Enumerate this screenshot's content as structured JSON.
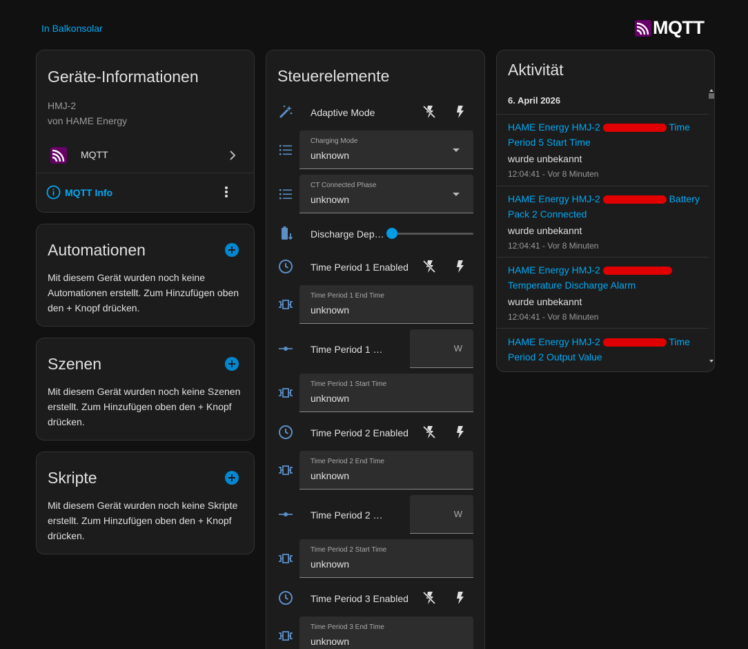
{
  "breadcrumb": "In Balkonsolar",
  "brand": {
    "name": "MQTT"
  },
  "colors": {
    "accent": "#03a9f4",
    "card_bg": "#1c1c1c",
    "page_bg": "#111111",
    "redaction": "#e00000"
  },
  "device_info": {
    "title": "Geräte-Informationen",
    "model": "HMJ-2",
    "vendor": "von HAME Energy",
    "integration_label": "MQTT",
    "info_link": "MQTT Info"
  },
  "automations": {
    "title": "Automationen",
    "description": "Mit diesem Gerät wurden noch keine Automationen erstellt. Zum Hinzufügen oben den + Knopf drücken."
  },
  "scenes": {
    "title": "Szenen",
    "description": "Mit diesem Gerät wurden noch keine Szenen erstellt. Zum Hinzufügen oben den + Knopf drücken."
  },
  "scripts": {
    "title": "Skripte",
    "description": "Mit diesem Gerät wurden noch keine Skripte erstellt. Zum Hinzufügen oben den + Knopf drücken."
  },
  "controls": {
    "title": "Steuerelemente",
    "adaptive_mode": "Adaptive Mode",
    "charging_mode": {
      "label": "Charging Mode",
      "value": "unknown"
    },
    "ct_phase": {
      "label": "CT Connected Phase",
      "value": "unknown"
    },
    "discharge_depth": {
      "name": "Discharge Dep…",
      "level": 0
    },
    "tp1_enabled": "Time Period 1 Enabled",
    "tp1_end": {
      "label": "Time Period 1 End Time",
      "value": "unknown"
    },
    "tp1_output": {
      "name": "Time Period 1 …",
      "unit": "W"
    },
    "tp1_start": {
      "label": "Time Period 1 Start Time",
      "value": "unknown"
    },
    "tp2_enabled": "Time Period 2 Enabled",
    "tp2_end": {
      "label": "Time Period 2 End Time",
      "value": "unknown"
    },
    "tp2_output": {
      "name": "Time Period 2 …",
      "unit": "W"
    },
    "tp2_start": {
      "label": "Time Period 2 Start Time",
      "value": "unknown"
    },
    "tp3_enabled": "Time Period 3 Enabled",
    "tp3_end": {
      "label": "Time Period 3 End Time",
      "value": "unknown"
    }
  },
  "activity": {
    "title": "Aktivität",
    "date": "6. April 2026",
    "entries": [
      {
        "link_a": "HAME Energy HMJ-2 ",
        "link_b": " Time Period 5 Start Time",
        "message": "wurde unbekannt",
        "time": "12:04:41 - Vor 8 Minuten"
      },
      {
        "link_a": "HAME Energy HMJ-2 ",
        "link_b": " Battery Pack 2 Connected",
        "message": "wurde unbekannt",
        "time": "12:04:41 - Vor 8 Minuten"
      },
      {
        "link_a": "HAME Energy HMJ-2 ",
        "link_b": " Temperature Discharge Alarm",
        "message": "wurde unbekannt",
        "time": "12:04:41 - Vor 8 Minuten"
      },
      {
        "link_a": "HAME Energy HMJ-2 ",
        "link_b": " Time Period 2 Output Value"
      }
    ]
  }
}
